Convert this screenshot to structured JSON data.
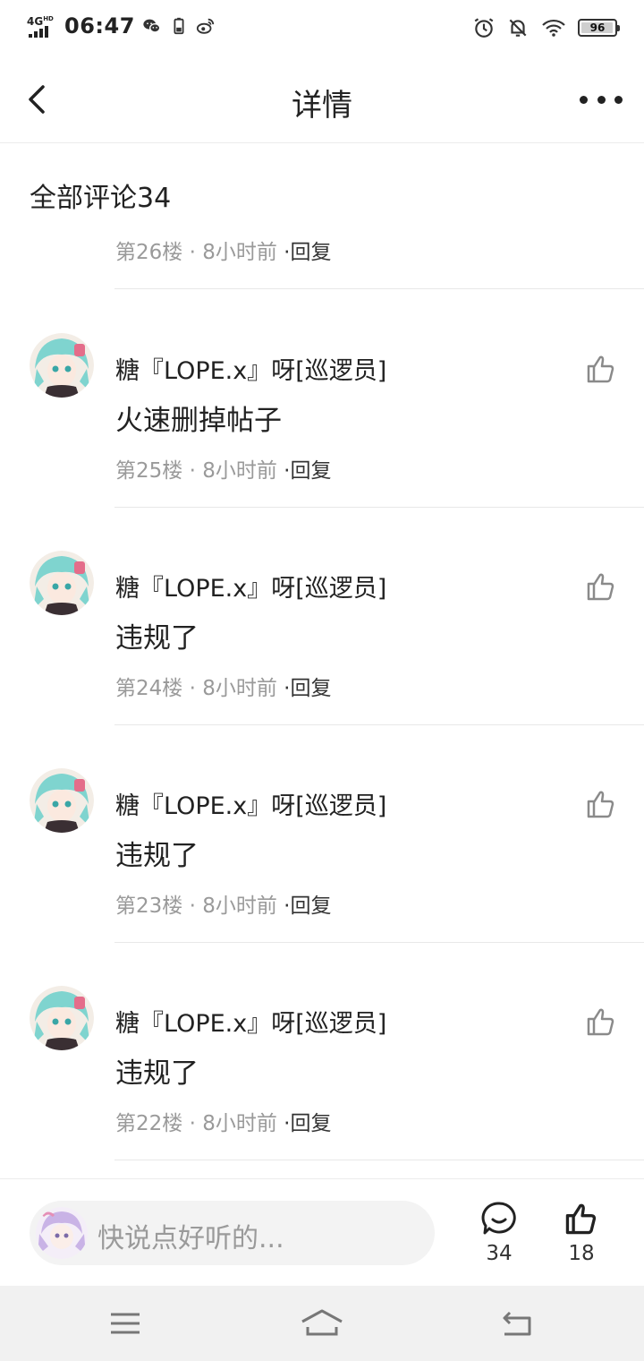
{
  "status_bar": {
    "network": "4G",
    "network_sub": "HD",
    "time": "06:47",
    "battery": "96"
  },
  "header": {
    "title": "详情"
  },
  "comments_heading": {
    "label": "全部评论",
    "count": "34"
  },
  "partial_comment": {
    "floor": "第26楼",
    "time": "· 8小时前",
    "reply": "·回复"
  },
  "comments": [
    {
      "username": "糖『LOPE.x』呀[巡逻员]",
      "content": "火速删掉帖子",
      "floor": "第25楼",
      "time": "· 8小时前",
      "reply": "·回复"
    },
    {
      "username": "糖『LOPE.x』呀[巡逻员]",
      "content": "违规了",
      "floor": "第24楼",
      "time": "· 8小时前",
      "reply": "·回复"
    },
    {
      "username": "糖『LOPE.x』呀[巡逻员]",
      "content": "违规了",
      "floor": "第23楼",
      "time": "· 8小时前",
      "reply": "·回复"
    },
    {
      "username": "糖『LOPE.x』呀[巡逻员]",
      "content": "违规了",
      "floor": "第22楼",
      "time": "· 8小时前",
      "reply": "·回复"
    }
  ],
  "input_bar": {
    "placeholder": "快说点好听的...",
    "comment_count": "34",
    "like_count": "18"
  },
  "icons": {
    "back": "back-arrow-icon",
    "more": "more-dots-icon",
    "like": "thumbs-up-icon",
    "comment": "comment-bubble-icon"
  },
  "colors": {
    "text": "#222222",
    "meta": "#9a9a9a",
    "icon_gray": "#8a8a8a",
    "divider": "#e8e8e8"
  }
}
